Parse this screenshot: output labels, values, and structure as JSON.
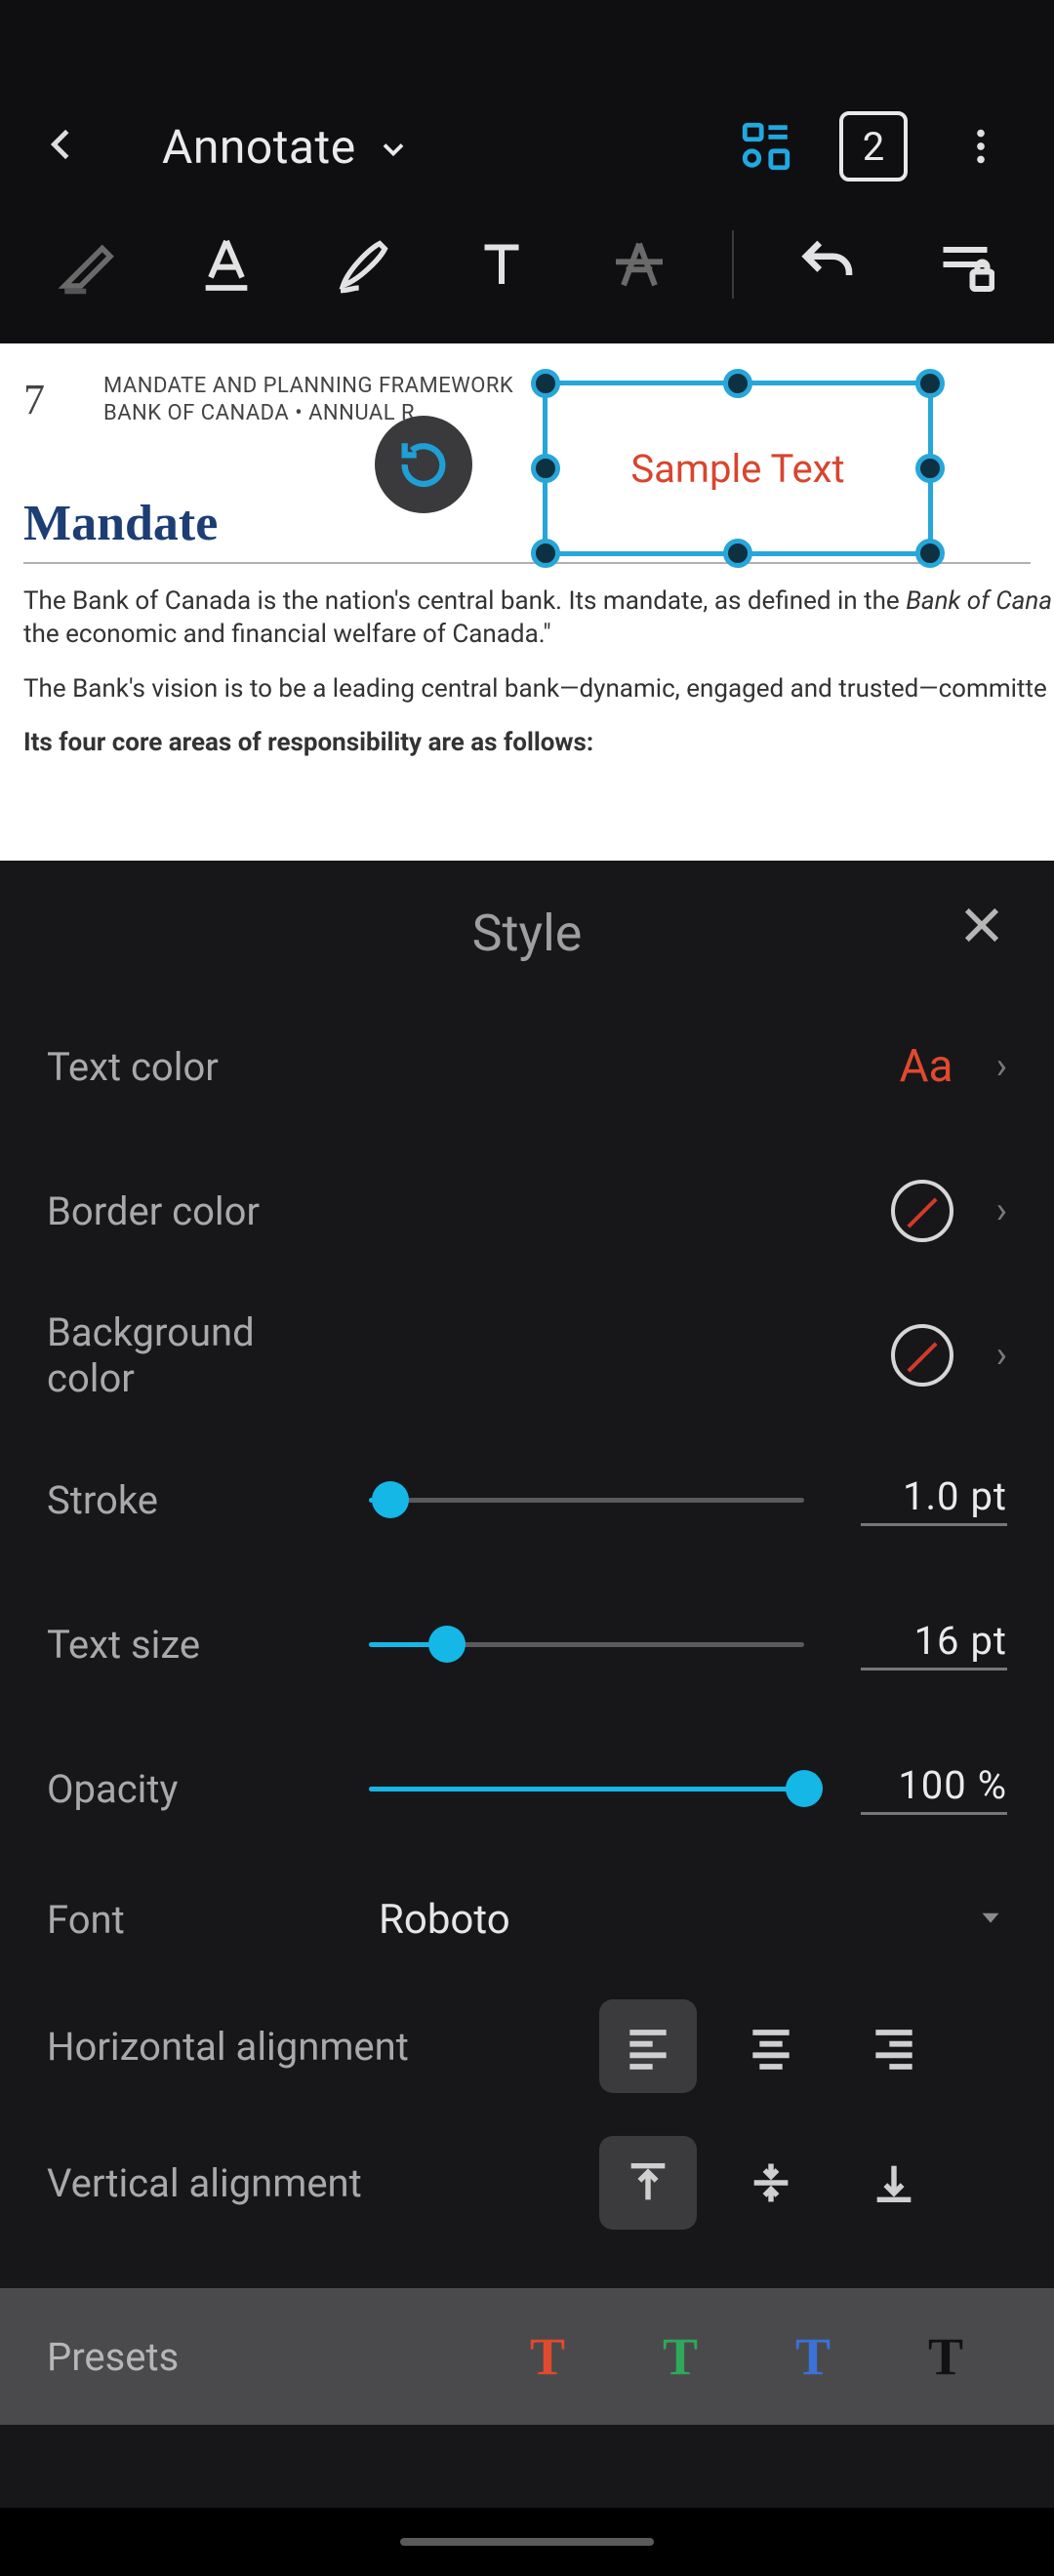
{
  "header": {
    "mode_label": "Annotate",
    "page_indicator": "2"
  },
  "document": {
    "page_number": "7",
    "meta_line1": "MANDATE AND PLANNING FRAMEWORK",
    "meta_line2": "BANK OF CANADA • ANNUAL R",
    "selection_text": "Sample Text",
    "heading": "Mandate",
    "para1_a": "The Bank of Canada is the nation's central bank. Its mandate, as defined in the ",
    "para1_i": "Bank of Cana",
    "para1_b": "the economic and financial welfare of Canada.\"",
    "para2": "The Bank's vision is to be a leading central bank—dynamic, engaged and trusted—committe",
    "para3": "Its four core areas of responsibility are as follows:"
  },
  "panel": {
    "title": "Style",
    "rows": {
      "text_color": {
        "label": "Text color",
        "sample": "Aa",
        "color": "#e04a2e"
      },
      "border_color": {
        "label": "Border color"
      },
      "background_color": {
        "label": "Background color"
      },
      "stroke": {
        "label": "Stroke",
        "value": "1.0 pt",
        "pct": 5
      },
      "text_size": {
        "label": "Text size",
        "value": "16 pt",
        "pct": 18
      },
      "opacity": {
        "label": "Opacity",
        "value": "100 %",
        "pct": 100
      },
      "font": {
        "label": "Font",
        "value": "Roboto"
      },
      "h_align": {
        "label": "Horizontal alignment"
      },
      "v_align": {
        "label": "Vertical alignment"
      }
    },
    "presets": {
      "label": "Presets",
      "items": [
        {
          "glyph": "T",
          "color": "#e04a2e"
        },
        {
          "glyph": "T",
          "color": "#2fa85a"
        },
        {
          "glyph": "T",
          "color": "#3a72d8"
        },
        {
          "glyph": "T",
          "color": "#111111"
        }
      ]
    }
  }
}
